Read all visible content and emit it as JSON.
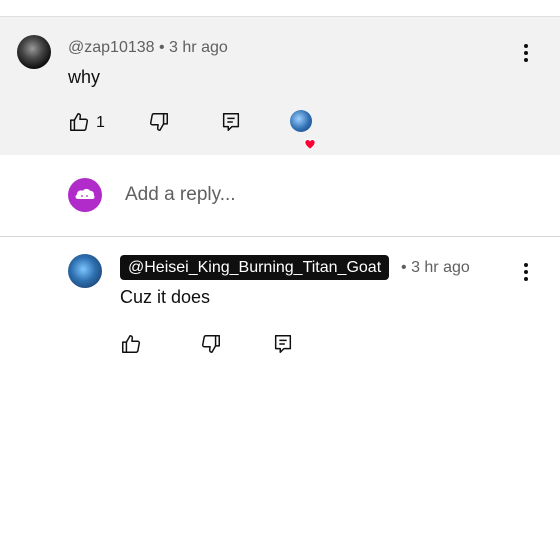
{
  "comment": {
    "author": "@zap10138",
    "separator": "•",
    "time": "3 hr ago",
    "text": "why",
    "like_count": "1"
  },
  "reply_box": {
    "placeholder": "Add a reply..."
  },
  "reply": {
    "author": "@Heisei_King_Burning_Titan_Goat",
    "separator": "•",
    "time": "3 hr ago",
    "text": "Cuz it does"
  },
  "icons": {
    "like": "thumbs-up-icon",
    "dislike": "thumbs-down-icon",
    "reply": "comment-reply-icon",
    "more": "more-vert-icon",
    "heart": "heart-icon"
  },
  "colors": {
    "heart": "#ff0033",
    "reply_avatar_bg": "#b02bc9",
    "comment_bg": "#f2f2f2"
  }
}
